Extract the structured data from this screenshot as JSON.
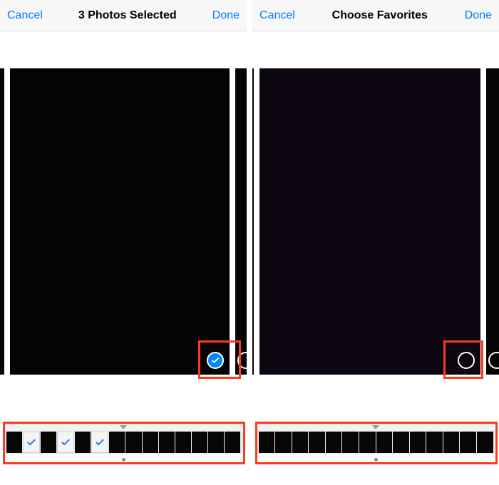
{
  "left": {
    "nav": {
      "cancel": "Cancel",
      "title": "3 Photos Selected",
      "done": "Done"
    },
    "photo_selected": true,
    "filmstrip": {
      "count": 14,
      "selected_indices": [
        1,
        3,
        5
      ]
    }
  },
  "right": {
    "nav": {
      "cancel": "Cancel",
      "title": "Choose Favorites",
      "done": "Done"
    },
    "photo_selected": false,
    "filmstrip": {
      "count": 14,
      "selected_indices": []
    }
  },
  "colors": {
    "ios_blue": "#007aff",
    "highlight": "#ff3b1f"
  }
}
